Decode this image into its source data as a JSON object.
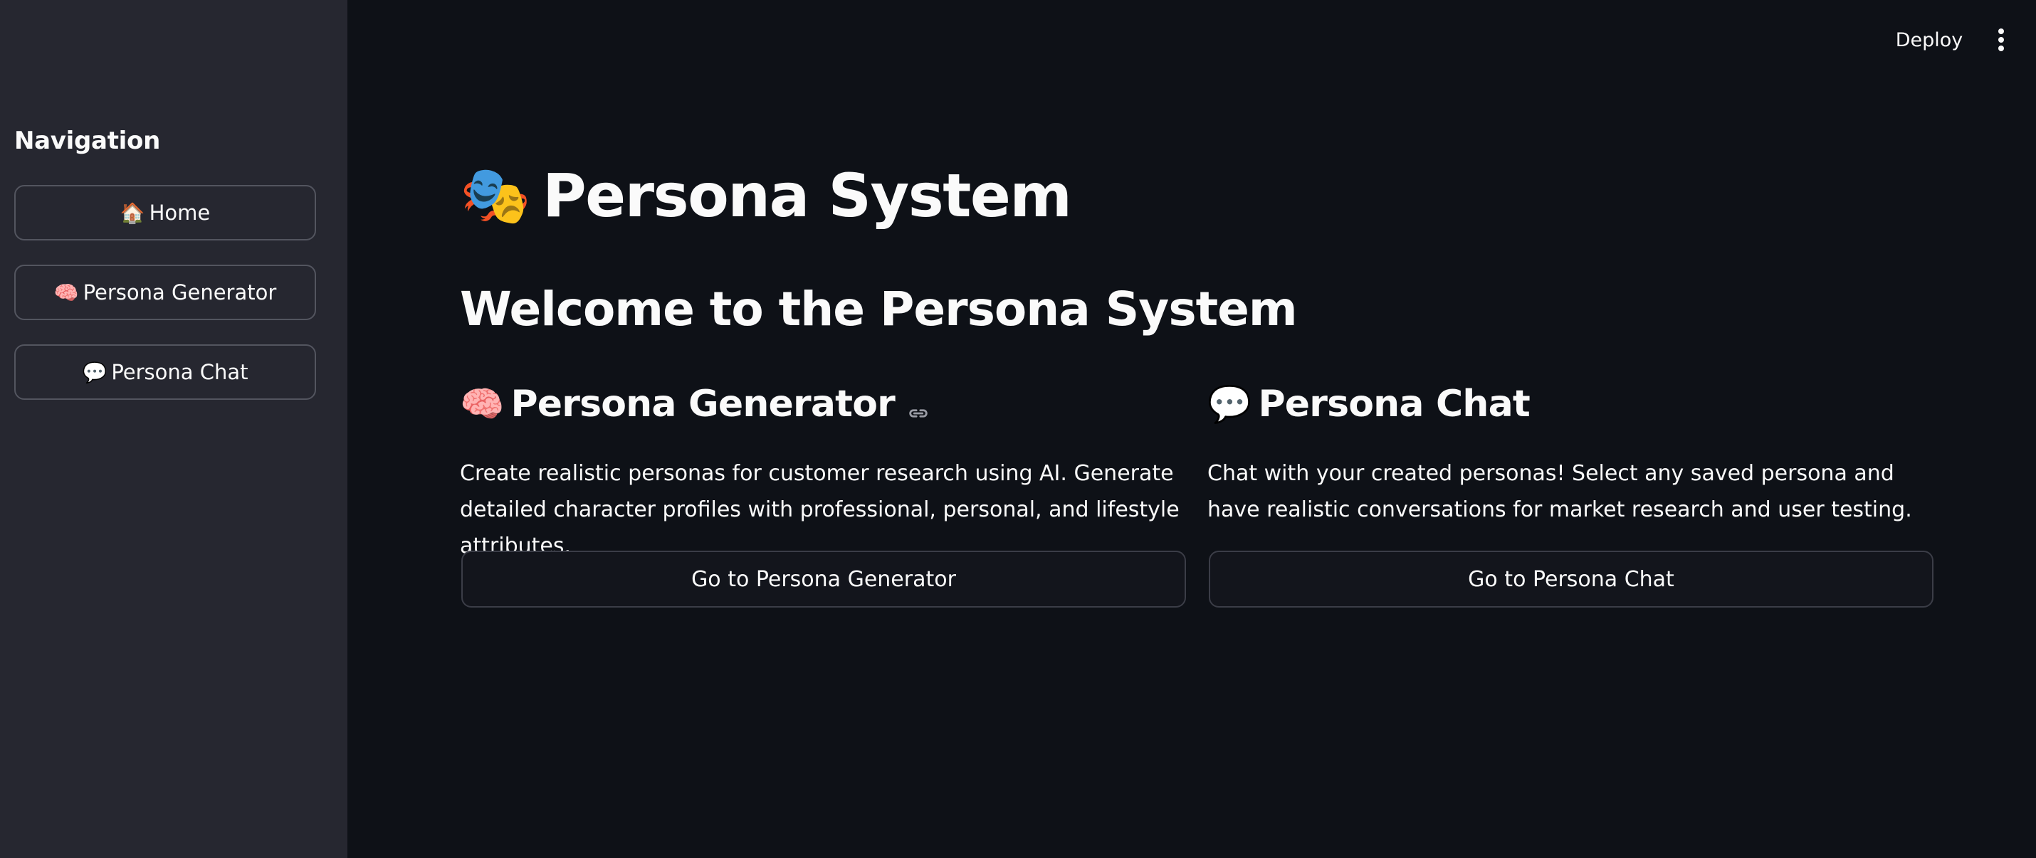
{
  "header": {
    "deploy_label": "Deploy",
    "menu_icon": "kebab-menu-icon"
  },
  "sidebar": {
    "title": "Navigation",
    "items": [
      {
        "icon": "🏠",
        "icon_name": "house-icon",
        "label": "Home"
      },
      {
        "icon": "🧠",
        "icon_name": "brain-icon",
        "label": "Persona Generator"
      },
      {
        "icon": "💬",
        "icon_name": "speech-bubble-icon",
        "label": "Persona Chat"
      }
    ]
  },
  "main": {
    "title_icon": "🎭",
    "title_icon_name": "theater-masks-icon",
    "title": "Persona System",
    "welcome": "Welcome to the Persona System",
    "columns": [
      {
        "icon": "🧠",
        "icon_name": "brain-icon",
        "heading": "Persona Generator",
        "anchor_icon": "link-icon",
        "description": "Create realistic personas for customer research using AI. Generate detailed character profiles with professional, personal, and lifestyle attributes.",
        "button_label": "Go to Persona Generator"
      },
      {
        "icon": "💬",
        "icon_name": "speech-bubble-icon",
        "heading": "Persona Chat",
        "description": "Chat with your created personas! Select any saved persona and have realistic conversations for market research and user testing.",
        "button_label": "Go to Persona Chat"
      }
    ]
  },
  "colors": {
    "background": "#0e1117",
    "sidebar": "#262730",
    "text": "#fafafa",
    "border": "#53555f"
  }
}
